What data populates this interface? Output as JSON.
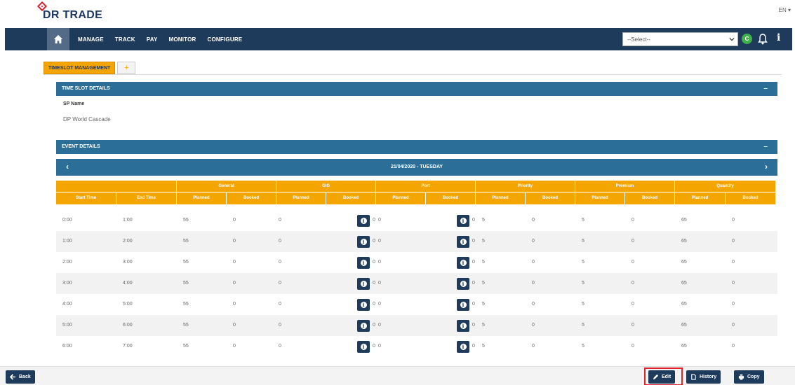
{
  "app": {
    "logo_text": "DR TRADE",
    "language": "EN ▾"
  },
  "nav": {
    "items": [
      "MANAGE",
      "TRACK",
      "PAY",
      "MONITOR",
      "CONFIGURE"
    ],
    "select_value": "--Select--",
    "badge": "C",
    "info": "i"
  },
  "tabs": {
    "active": "TIMESLOT MANAGEMENT",
    "add": "+"
  },
  "sections": {
    "timeslot": {
      "title": "TIME SLOT DETAILS",
      "toggle": "–"
    },
    "event": {
      "title": "EVENT DETAILS",
      "toggle": "–"
    }
  },
  "sp": {
    "label": "SP Name",
    "value": "DP World Cascade"
  },
  "date_nav": {
    "prev": "‹",
    "date": "21/04/2020 - TUESDAY",
    "next": "›"
  },
  "table": {
    "groups": [
      "General",
      "GIG",
      "Port",
      "Priority",
      "Premium",
      "Quantity"
    ],
    "headers": [
      "Start Time",
      "End Time",
      "Planned",
      "Booked",
      "Planned",
      "Booked",
      "Planned",
      "Booked",
      "Planned",
      "Booked",
      "Planned",
      "Booked",
      "Planned",
      "Booked"
    ],
    "rows": [
      [
        "0:00",
        "1:00",
        "55",
        "0",
        "0",
        "0",
        "0",
        "0",
        "5",
        "0",
        "5",
        "0",
        "65",
        "0"
      ],
      [
        "1:00",
        "2:00",
        "55",
        "0",
        "0",
        "0",
        "0",
        "0",
        "5",
        "0",
        "5",
        "0",
        "65",
        "0"
      ],
      [
        "2:00",
        "3:00",
        "55",
        "0",
        "0",
        "0",
        "0",
        "0",
        "5",
        "0",
        "5",
        "0",
        "65",
        "0"
      ],
      [
        "3:00",
        "4:00",
        "55",
        "0",
        "0",
        "0",
        "0",
        "0",
        "5",
        "0",
        "5",
        "0",
        "65",
        "0"
      ],
      [
        "4:00",
        "5:00",
        "55",
        "0",
        "0",
        "0",
        "0",
        "0",
        "5",
        "0",
        "5",
        "0",
        "65",
        "0"
      ],
      [
        "5:00",
        "6:00",
        "55",
        "0",
        "0",
        "0",
        "0",
        "0",
        "5",
        "0",
        "5",
        "0",
        "65",
        "0"
      ],
      [
        "6:00",
        "7:00",
        "55",
        "0",
        "0",
        "0",
        "0",
        "0",
        "5",
        "0",
        "5",
        "0",
        "65",
        "0"
      ]
    ]
  },
  "footer": {
    "back": "Back",
    "edit": "Edit",
    "history": "History",
    "copy": "Copy"
  },
  "colors": {
    "nav": "#1f3b5c",
    "section": "#2b6f99",
    "accent": "#f5a500",
    "highlight": "#e0242c"
  }
}
